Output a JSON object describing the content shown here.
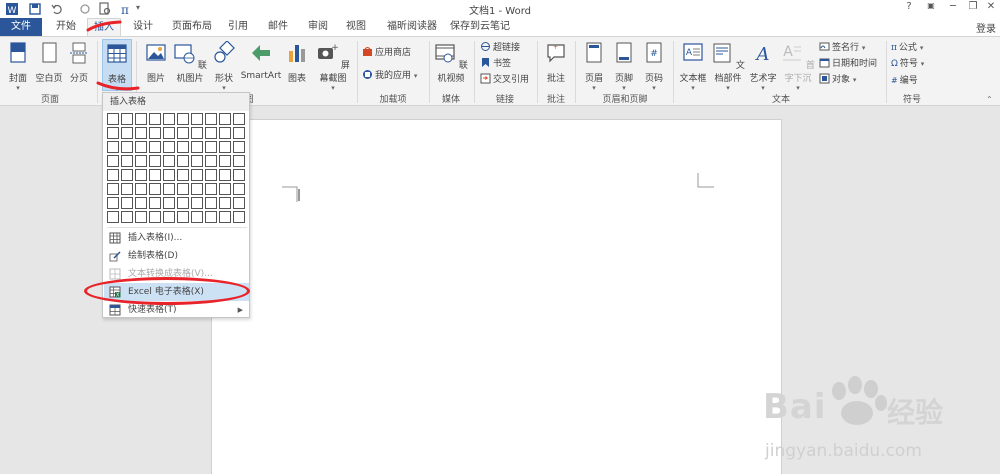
{
  "titlebar": {
    "title": "文档1 - Word",
    "help": "?",
    "minimize": "─",
    "restore": "❐",
    "close": "✕"
  },
  "tabs": [
    {
      "label": "文件"
    },
    {
      "label": "开始"
    },
    {
      "label": "插入"
    },
    {
      "label": "设计"
    },
    {
      "label": "页面布局"
    },
    {
      "label": "引用"
    },
    {
      "label": "邮件"
    },
    {
      "label": "审阅"
    },
    {
      "label": "视图"
    },
    {
      "label": "福昕阅读器"
    },
    {
      "label": "保存到云笔记"
    }
  ],
  "login_label": "登录",
  "ribbon": {
    "cover": "封面",
    "blank_page": "空白页",
    "page_break": "分页",
    "table": "表格",
    "picture": "图片",
    "online_picture": "联机图片",
    "shapes": "形状",
    "smartart": "SmartArt",
    "chart": "图表",
    "screenshot": "屏幕截图",
    "store": "应用商店",
    "my_apps": "我的应用",
    "online_video": "联机视频",
    "hyperlink": "超链接",
    "bookmark": "书签",
    "cross_ref": "交叉引用",
    "comment": "批注",
    "header": "页眉",
    "footer": "页脚",
    "page_number": "页码",
    "textbox": "文本框",
    "quick_parts": "文档部件",
    "wordart": "艺术字",
    "dropcap": "首字下沉",
    "signature": "签名行",
    "datetime": "日期和时间",
    "object": "对象",
    "equation": "公式",
    "symbol": "符号",
    "numbering": "编号"
  },
  "groups": {
    "pages": "页面",
    "illustrations_tail": "图",
    "addins": "加载项",
    "media": "媒体",
    "links": "链接",
    "comments": "批注",
    "header_footer": "页眉和页脚",
    "text": "文本",
    "symbols": "符号"
  },
  "dropdown": {
    "title": "插入表格",
    "insert_table": "插入表格(I)...",
    "draw_table": "绘制表格(D)",
    "text_to_table": "文本转换成表格(V)...",
    "excel_table": "Excel 电子表格(X)",
    "quick_table": "快速表格(T)",
    "grid_cols": 10,
    "grid_rows": 8
  },
  "watermark": {
    "brand": "Bai",
    "brand_tail": "经验",
    "url": "jingyan.baidu.com"
  },
  "colors": {
    "accent": "#2b579a",
    "highlight": "#cde1f5",
    "annotation": "#e8232a"
  }
}
